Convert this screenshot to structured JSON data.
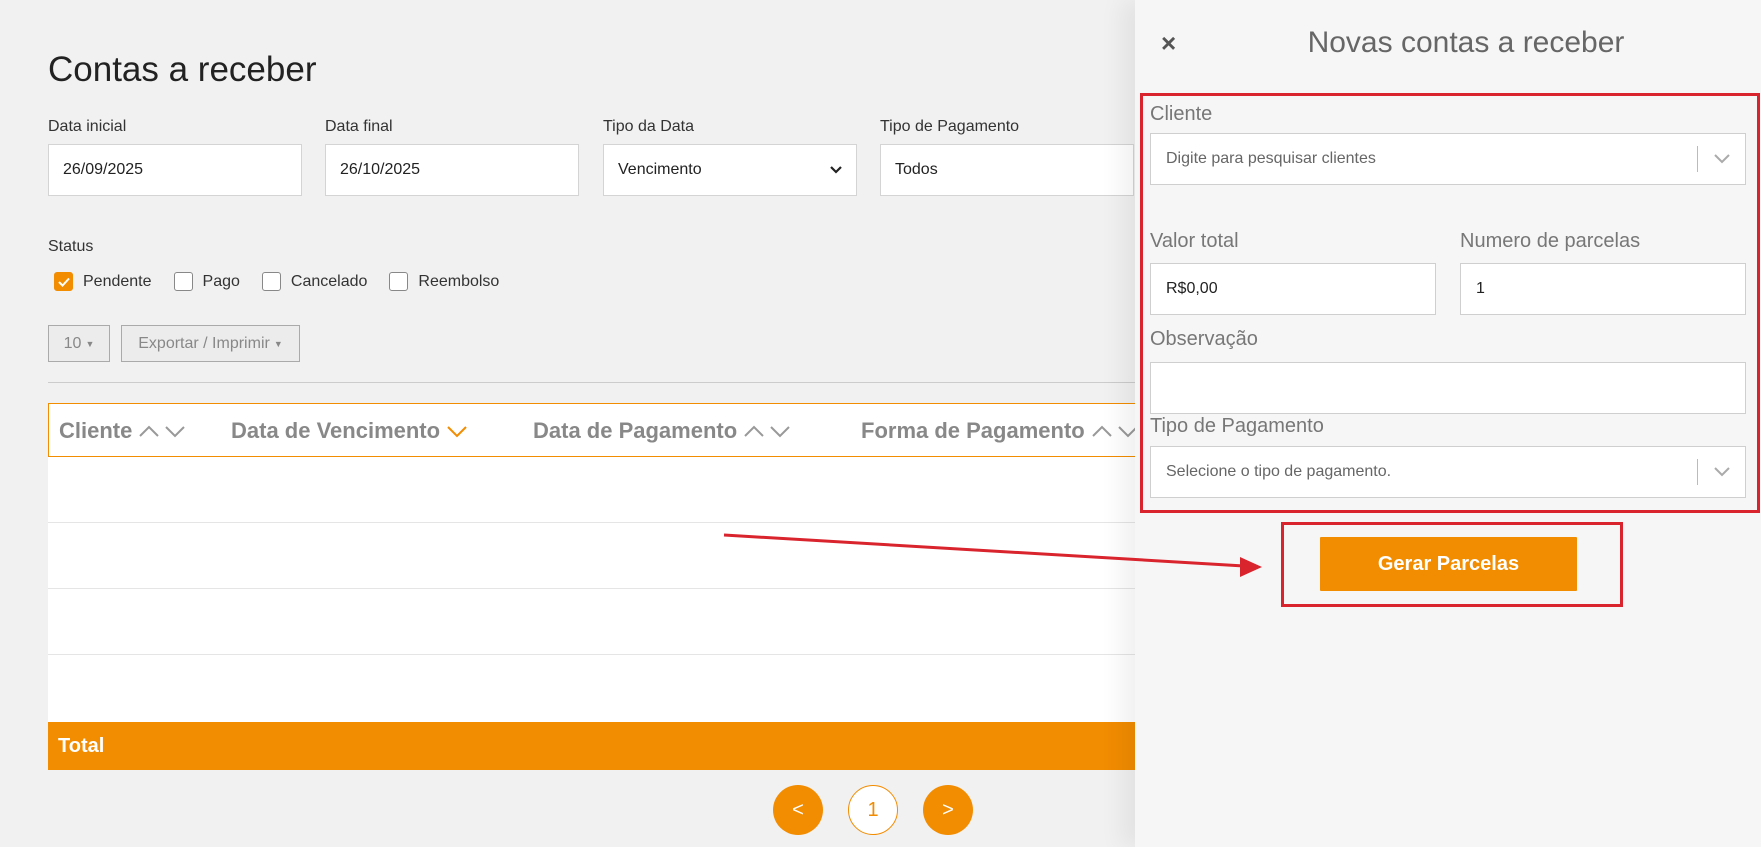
{
  "page": {
    "title": "Contas a receber"
  },
  "filters": [
    {
      "label": "Data inicial",
      "value": "26/09/2025"
    },
    {
      "label": "Data final",
      "value": "26/10/2025"
    },
    {
      "label": "Tipo da Data",
      "value": "Vencimento"
    },
    {
      "label": "Tipo de Pagamento",
      "value": "Todos"
    }
  ],
  "status": {
    "label": "Status",
    "options": [
      {
        "label": "Pendente",
        "checked": true
      },
      {
        "label": "Pago",
        "checked": false
      },
      {
        "label": "Cancelado",
        "checked": false
      },
      {
        "label": "Reembolso",
        "checked": false
      }
    ]
  },
  "toolbar": {
    "page_size": "10",
    "export_label": "Exportar / Imprimir"
  },
  "table": {
    "columns": [
      "Cliente",
      "Data de Vencimento",
      "Data de Pagamento",
      "Forma de Pagamento"
    ],
    "total_label": "Total"
  },
  "pagination": {
    "prev": "<",
    "current": "1",
    "next": ">"
  },
  "panel": {
    "title": "Novas contas a receber",
    "close": "×",
    "cliente_label": "Cliente",
    "cliente_placeholder": "Digite para pesquisar clientes",
    "valor_label": "Valor total",
    "valor_value": "R$0,00",
    "parcelas_label": "Numero de parcelas",
    "parcelas_value": "1",
    "observacao_label": "Observação",
    "observacao_value": "",
    "tipo_label": "Tipo de Pagamento",
    "tipo_placeholder": "Selecione o tipo de pagamento.",
    "submit_label": "Gerar Parcelas"
  },
  "colors": {
    "accent": "#f28c00",
    "highlight": "#d9232d"
  }
}
